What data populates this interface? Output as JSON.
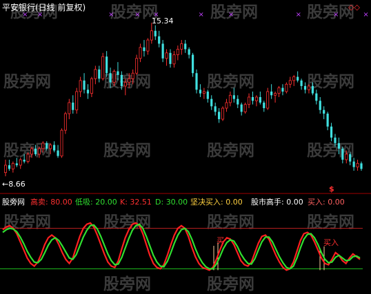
{
  "window": {
    "title": "平安银行(日线 前复权)"
  },
  "watermark": {
    "text": "股旁网"
  },
  "upper_panel": {
    "high_label": "15.34",
    "low_label": "←8.66",
    "sell_signal": "$",
    "corner_marker": "◇◇",
    "colors": {
      "up": "#ff3030",
      "down": "#40e0e0",
      "cross": "#c040ff"
    },
    "candles": [
      [
        7.2,
        7.9,
        7.0,
        7.6
      ],
      [
        7.6,
        7.9,
        7.3,
        7.4
      ],
      [
        7.4,
        7.8,
        7.2,
        7.7
      ],
      [
        7.7,
        8.0,
        7.5,
        7.6
      ],
      [
        7.6,
        8.0,
        7.4,
        7.9
      ],
      [
        7.9,
        8.2,
        7.7,
        7.8
      ],
      [
        7.8,
        8.3,
        7.7,
        8.2
      ],
      [
        8.2,
        8.6,
        8.0,
        8.5
      ],
      [
        8.5,
        8.7,
        8.1,
        8.2
      ],
      [
        8.2,
        8.6,
        8.0,
        8.5
      ],
      [
        8.5,
        8.9,
        8.3,
        8.8
      ],
      [
        8.8,
        8.9,
        8.4,
        8.5
      ],
      [
        8.5,
        8.8,
        8.2,
        8.7
      ],
      [
        8.7,
        8.9,
        8.3,
        8.4
      ],
      [
        8.4,
        8.7,
        8.0,
        8.1
      ],
      [
        8.1,
        9.6,
        8.0,
        9.5
      ],
      [
        9.5,
        10.5,
        9.3,
        10.4
      ],
      [
        10.4,
        11.2,
        10.1,
        11.0
      ],
      [
        11.0,
        11.4,
        10.4,
        10.6
      ],
      [
        10.6,
        11.8,
        10.4,
        11.6
      ],
      [
        11.6,
        12.4,
        11.3,
        12.2
      ],
      [
        12.2,
        12.6,
        11.5,
        11.7
      ],
      [
        11.7,
        12.0,
        11.2,
        11.5
      ],
      [
        11.5,
        12.4,
        11.3,
        12.3
      ],
      [
        12.3,
        13.0,
        12.0,
        12.8
      ],
      [
        12.8,
        13.0,
        12.1,
        12.3
      ],
      [
        12.3,
        13.7,
        12.2,
        13.5
      ],
      [
        13.5,
        13.8,
        12.4,
        12.6
      ],
      [
        12.6,
        12.9,
        11.8,
        12.1
      ],
      [
        12.1,
        12.8,
        11.9,
        12.7
      ],
      [
        12.7,
        13.2,
        12.2,
        12.5
      ],
      [
        12.5,
        12.7,
        11.7,
        11.9
      ],
      [
        11.9,
        12.3,
        11.4,
        12.1
      ],
      [
        12.1,
        12.6,
        11.8,
        12.3
      ],
      [
        12.3,
        12.8,
        12.0,
        12.6
      ],
      [
        12.6,
        13.6,
        12.5,
        13.4
      ],
      [
        13.4,
        14.2,
        13.2,
        14.0
      ],
      [
        14.0,
        14.4,
        13.5,
        13.8
      ],
      [
        13.8,
        14.5,
        13.6,
        14.4
      ],
      [
        14.4,
        15.34,
        14.2,
        14.9
      ],
      [
        14.9,
        15.2,
        14.4,
        14.6
      ],
      [
        14.6,
        14.9,
        14.0,
        14.2
      ],
      [
        14.2,
        14.4,
        13.2,
        13.4
      ],
      [
        13.4,
        13.9,
        13.0,
        13.7
      ],
      [
        13.7,
        13.9,
        12.9,
        13.1
      ],
      [
        13.1,
        13.8,
        12.9,
        13.6
      ],
      [
        13.6,
        14.1,
        13.3,
        13.9
      ],
      [
        13.9,
        14.4,
        13.6,
        14.2
      ],
      [
        14.2,
        14.4,
        13.7,
        13.9
      ],
      [
        13.9,
        14.0,
        13.4,
        13.6
      ],
      [
        13.6,
        13.7,
        12.4,
        12.6
      ],
      [
        12.6,
        12.8,
        11.5,
        11.7
      ],
      [
        11.7,
        12.0,
        11.3,
        11.5
      ],
      [
        11.5,
        11.8,
        11.2,
        11.6
      ],
      [
        11.6,
        11.7,
        11.0,
        11.2
      ],
      [
        11.2,
        11.4,
        10.6,
        10.8
      ],
      [
        10.8,
        11.0,
        10.3,
        10.5
      ],
      [
        10.5,
        10.7,
        9.9,
        10.1
      ],
      [
        10.1,
        10.8,
        10.0,
        10.7
      ],
      [
        10.7,
        11.2,
        10.5,
        11.0
      ],
      [
        11.0,
        11.6,
        10.8,
        11.4
      ],
      [
        11.4,
        11.8,
        11.0,
        11.2
      ],
      [
        11.2,
        11.4,
        10.7,
        10.9
      ],
      [
        10.9,
        11.0,
        10.3,
        10.5
      ],
      [
        10.5,
        11.0,
        10.4,
        10.9
      ],
      [
        10.9,
        11.5,
        10.7,
        11.3
      ],
      [
        11.3,
        11.6,
        10.9,
        11.1
      ],
      [
        11.1,
        11.4,
        10.8,
        11.3
      ],
      [
        11.3,
        11.6,
        10.9,
        11.0
      ],
      [
        11.0,
        11.1,
        10.5,
        10.7
      ],
      [
        10.7,
        11.8,
        10.6,
        11.6
      ],
      [
        11.6,
        12.0,
        11.2,
        11.4
      ],
      [
        11.4,
        11.6,
        11.0,
        11.5
      ],
      [
        11.5,
        11.9,
        11.3,
        11.8
      ],
      [
        11.8,
        12.0,
        11.4,
        11.6
      ],
      [
        11.6,
        12.1,
        11.5,
        12.0
      ],
      [
        12.0,
        12.4,
        11.8,
        12.2
      ],
      [
        12.2,
        12.5,
        11.9,
        12.4
      ],
      [
        12.4,
        12.7,
        12.1,
        12.2
      ],
      [
        12.2,
        12.3,
        11.7,
        11.9
      ],
      [
        11.9,
        12.1,
        11.5,
        11.7
      ],
      [
        11.7,
        12.0,
        11.5,
        11.9
      ],
      [
        11.9,
        12.1,
        11.4,
        11.5
      ],
      [
        11.5,
        11.7,
        10.9,
        11.1
      ],
      [
        11.1,
        11.3,
        10.4,
        10.6
      ],
      [
        10.6,
        10.8,
        10.1,
        10.4
      ],
      [
        10.4,
        10.5,
        9.5,
        9.7
      ],
      [
        9.7,
        9.9,
        8.9,
        9.1
      ],
      [
        9.1,
        9.3,
        8.6,
        8.8
      ],
      [
        8.8,
        9.1,
        8.2,
        8.5
      ],
      [
        8.5,
        8.6,
        7.7,
        7.9
      ],
      [
        7.9,
        8.4,
        7.7,
        8.2
      ],
      [
        8.2,
        8.3,
        7.6,
        7.8
      ],
      [
        7.8,
        8.0,
        7.3,
        7.5
      ],
      [
        7.5,
        7.9,
        7.3,
        7.7
      ],
      [
        7.7,
        7.8,
        7.3,
        7.4
      ]
    ]
  },
  "indicator_panel": {
    "name": "股旁网",
    "legend": [
      {
        "label": "高卖:",
        "value": "80.00",
        "color": "#ff3030"
      },
      {
        "label": "低吸:",
        "value": "20.00",
        "color": "#30e030"
      },
      {
        "label": "K:",
        "value": "32.51",
        "color": "#ff3030"
      },
      {
        "label": "D:",
        "value": "30.00",
        "color": "#30e030"
      },
      {
        "label": "坚决买入:",
        "value": "0.00",
        "color": "#ffd040"
      },
      {
        "label": "股市高手:",
        "value": "0.00",
        "color": "#ffffff"
      },
      {
        "label": "买入:",
        "value": "0.00",
        "color": "#ff6060"
      }
    ],
    "levels": {
      "high": 80,
      "low": 20
    },
    "signal_labels": [
      "买",
      "买入"
    ],
    "k": [
      78,
      82,
      84,
      80,
      72,
      60,
      48,
      36,
      28,
      24,
      30,
      42,
      56,
      66,
      70,
      66,
      56,
      44,
      34,
      28,
      36,
      52,
      68,
      80,
      86,
      88,
      82,
      70,
      56,
      42,
      30,
      24,
      22,
      32,
      50,
      66,
      78,
      86,
      88,
      84,
      72,
      56,
      40,
      28,
      22,
      20,
      26,
      40,
      56,
      70,
      80,
      84,
      80,
      68,
      52,
      38,
      28,
      22,
      20,
      18,
      22,
      34,
      48,
      60,
      66,
      64,
      56,
      44,
      32,
      26,
      24,
      30,
      44,
      58,
      68,
      70,
      64,
      52,
      40,
      30,
      22,
      18,
      20,
      30,
      46,
      62,
      72,
      74,
      70,
      60,
      48,
      36,
      28,
      26,
      34,
      44,
      40,
      32,
      28,
      36,
      42,
      38,
      34
    ],
    "d": [
      74,
      78,
      80,
      79,
      75,
      67,
      57,
      46,
      37,
      30,
      29,
      34,
      44,
      55,
      63,
      66,
      62,
      54,
      45,
      36,
      34,
      41,
      54,
      67,
      77,
      84,
      85,
      79,
      68,
      55,
      42,
      32,
      26,
      27,
      37,
      51,
      65,
      77,
      84,
      86,
      80,
      68,
      54,
      40,
      30,
      24,
      23,
      31,
      44,
      58,
      70,
      78,
      80,
      75,
      64,
      50,
      38,
      29,
      23,
      20,
      20,
      27,
      38,
      50,
      59,
      63,
      61,
      53,
      42,
      34,
      28,
      27,
      35,
      48,
      60,
      67,
      67,
      60,
      49,
      38,
      29,
      22,
      20,
      24,
      36,
      51,
      64,
      71,
      72,
      66,
      56,
      44,
      34,
      29,
      30,
      37,
      40,
      36,
      32,
      33,
      38,
      39,
      36
    ]
  }
}
